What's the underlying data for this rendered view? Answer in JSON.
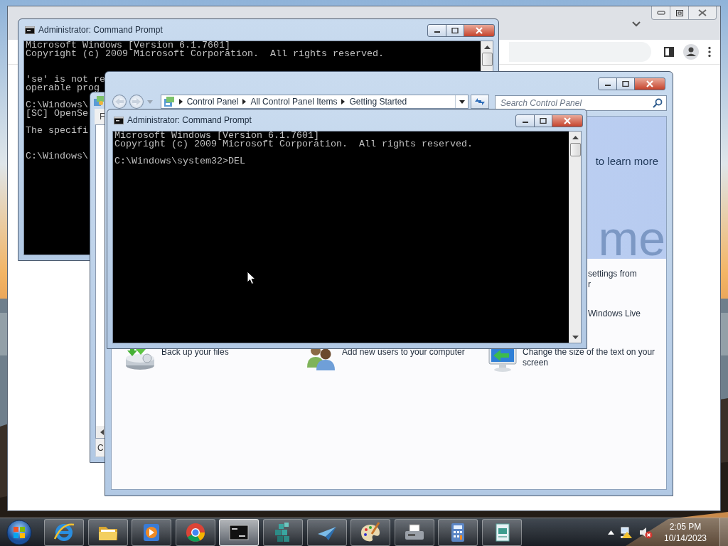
{
  "back_console": {
    "title": "Administrator:  Command Prompt",
    "blocks": [
      {
        "kind": "normal",
        "lines": [
          "Microsoft Windows [Version 6.1.7601]",
          "Copyright (c) 2009 Microsoft Corporation.  All rights reserved."
        ]
      },
      {
        "kind": "spaced",
        "lines": [
          "'se' is not re",
          "operable prog"
        ]
      },
      {
        "kind": "normal",
        "lines": [
          "C:\\Windows\\",
          "[SC] OpenSe"
        ]
      },
      {
        "kind": "normal",
        "lines": [
          "The specifi"
        ]
      },
      {
        "kind": "spaced",
        "lines": [
          "C:\\Windows\\"
        ]
      }
    ]
  },
  "partial_window": {
    "menu_text": "F",
    "status_text": "C"
  },
  "control_panel": {
    "breadcrumb": [
      "Control Panel",
      "All Control Panel Items",
      "Getting Started"
    ],
    "search": {
      "placeholder": "Search Control Panel"
    },
    "banner_text": "to learn more",
    "banner_heading": "me",
    "side_tasks": [
      "settings from\nr",
      "Windows Live"
    ],
    "tasks": [
      {
        "kind": "backup",
        "text": "Back up your files"
      },
      {
        "kind": "users",
        "text": "Add new users to your computer"
      },
      {
        "kind": "display",
        "text": "Change the size of the text on your screen"
      }
    ]
  },
  "front_console": {
    "title": "Administrator:  Command Prompt",
    "blocks": [
      {
        "kind": "normal",
        "lines": [
          "Microsoft Windows [Version 6.1.7601]",
          "Copyright (c) 2009 Microsoft Corporation.  All rights reserved."
        ]
      },
      {
        "kind": "normal",
        "lines": [
          "C:\\Windows\\system32>DEL"
        ]
      }
    ]
  },
  "taskbar": {
    "apps": [
      {
        "kind": "ie",
        "selected": false
      },
      {
        "kind": "folder",
        "selected": false
      },
      {
        "kind": "media",
        "selected": false
      },
      {
        "kind": "chrome",
        "selected": false
      },
      {
        "kind": "console",
        "selected": true
      },
      {
        "kind": "cubes",
        "selected": false
      },
      {
        "kind": "plane",
        "selected": false
      },
      {
        "kind": "palette",
        "selected": false
      },
      {
        "kind": "fax",
        "selected": false
      },
      {
        "kind": "calculator",
        "selected": false
      },
      {
        "kind": "document",
        "selected": false
      }
    ],
    "clock": {
      "time": "2:05 PM",
      "date": "10/14/2023"
    }
  }
}
